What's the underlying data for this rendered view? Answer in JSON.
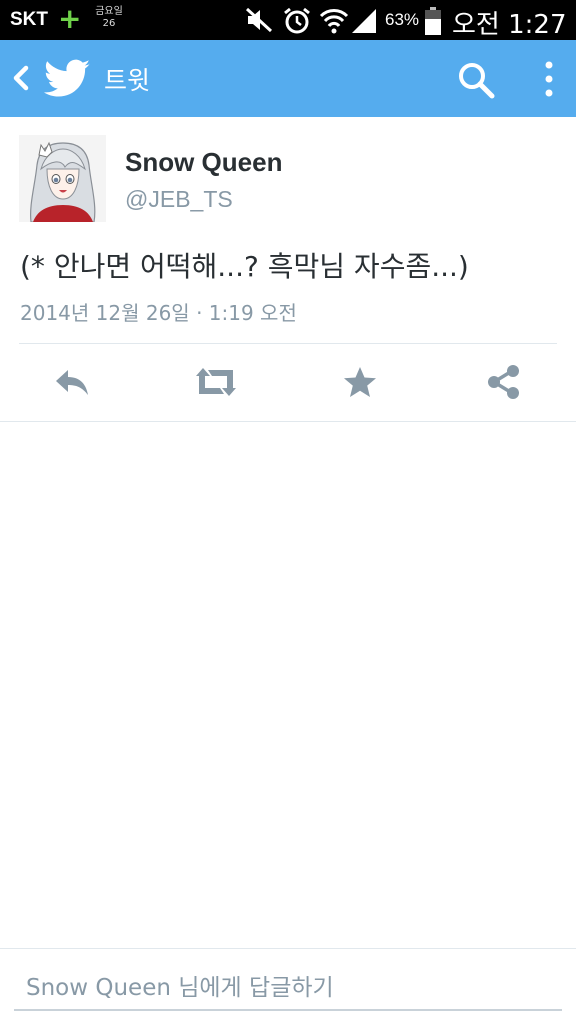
{
  "status_bar": {
    "carrier": "SKT",
    "date_small": "금요일 26",
    "battery_percent": "63%",
    "time": "오전 1:27",
    "icons": [
      "plus-icon",
      "mute-icon",
      "alarm-icon",
      "wifi-icon",
      "signal-icon",
      "battery-icon"
    ]
  },
  "action_bar": {
    "title": "트윗",
    "background": "#55acee",
    "icons": [
      "back-icon",
      "twitter-bird-icon",
      "search-icon",
      "more-icon"
    ]
  },
  "tweet": {
    "user_name": "Snow Queen",
    "user_handle": "@JEB_TS",
    "text": "(* 안나면 어떡해...? 흑막님 자수좀...)",
    "timestamp": "2014년 12월 26일 · 1:19 오전"
  },
  "actions": [
    "reply-icon",
    "retweet-icon",
    "favorite-icon",
    "share-icon"
  ],
  "reply": {
    "placeholder": "Snow Queen 님에게 답글하기"
  }
}
